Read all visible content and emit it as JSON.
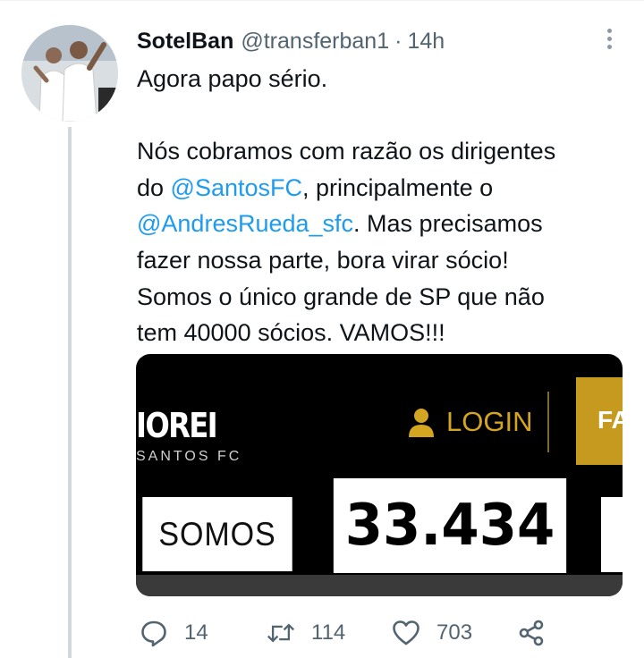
{
  "tweet": {
    "display_name": "SotelBan",
    "handle": "@transferban1",
    "separator": "·",
    "time": "14h",
    "lines": [
      [
        {
          "t": "Agora papo sério."
        }
      ],
      [
        {
          "t": ""
        }
      ],
      [
        {
          "t": "Nós cobramos com razão os dirigentes"
        }
      ],
      [
        {
          "t": "do "
        },
        {
          "t": "@SantosFC",
          "mention": true
        },
        {
          "t": ", principalmente o"
        }
      ],
      [
        {
          "t": "@AndresRueda_sfc",
          "mention": true
        },
        {
          "t": ". Mas precisamos"
        }
      ],
      [
        {
          "t": "fazer nossa parte, bora virar sócio!"
        }
      ],
      [
        {
          "t": "Somos o único grande de SP que não"
        }
      ],
      [
        {
          "t": "tem 40000 sócios. VAMOS!!!"
        }
      ]
    ]
  },
  "media": {
    "site_title": "IOREI",
    "site_subtitle": "SANTOS FC",
    "login_label": "LOGIN",
    "button_fragment": "FA",
    "somos_label": "SOMOS",
    "counter_value": "33.434",
    "gold_color": "#d4a520"
  },
  "actions": {
    "reply_count": "14",
    "retweet_count": "114",
    "like_count": "703"
  },
  "colors": {
    "mention": "#1d9bf0",
    "muted": "#536471"
  }
}
